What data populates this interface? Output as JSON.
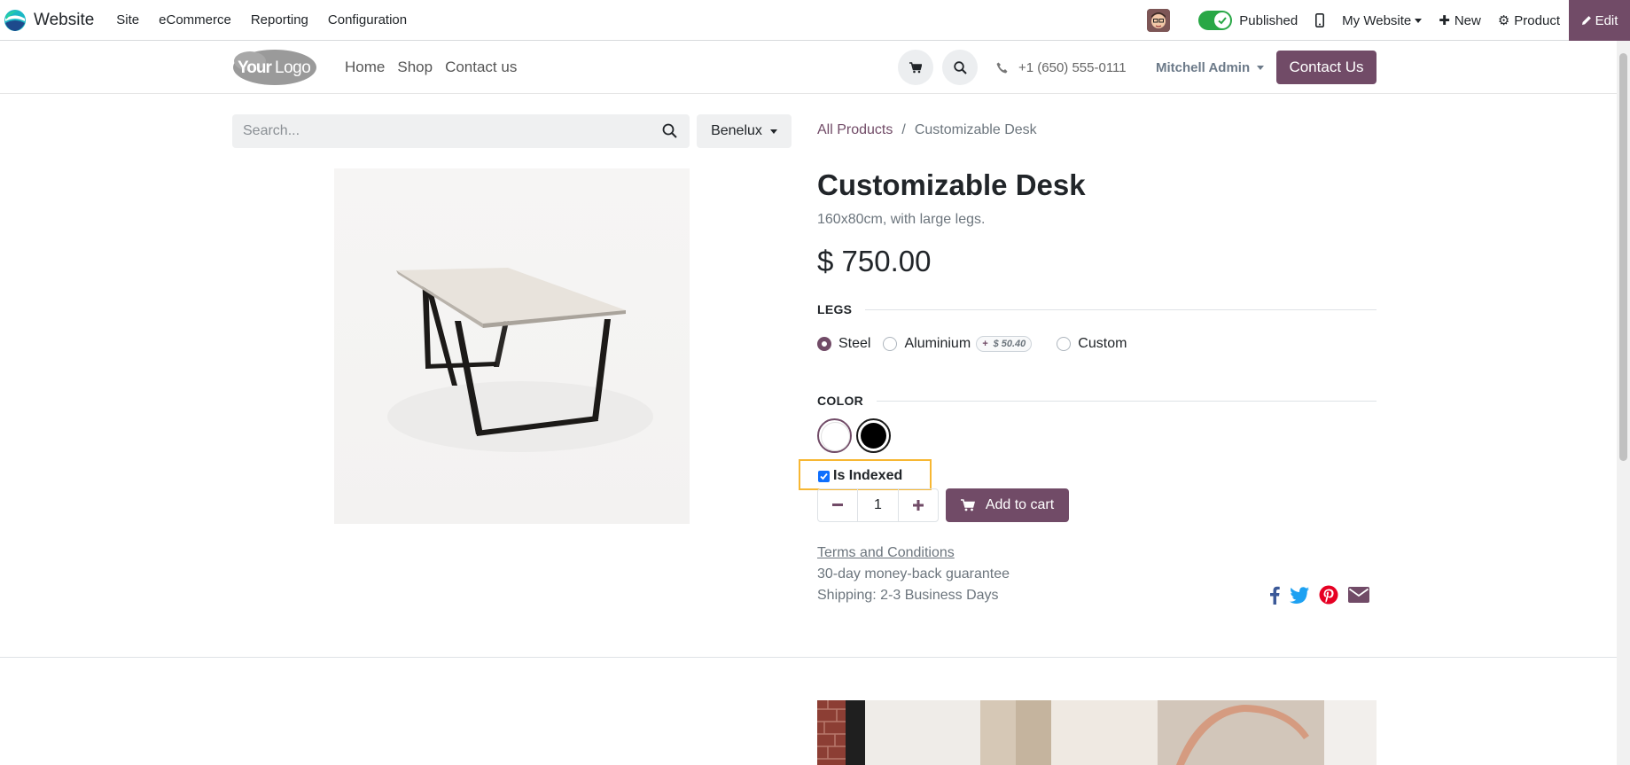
{
  "adminbar": {
    "app_name": "Website",
    "menus": [
      "Site",
      "eCommerce",
      "Reporting",
      "Configuration"
    ],
    "published_label": "Published",
    "my_website_label": "My Website",
    "new_label": "New",
    "product_label": "Product",
    "edit_label": "Edit",
    "accent_color": "#714b67"
  },
  "site": {
    "logo_text": "YourLogo",
    "nav": [
      "Home",
      "Shop",
      "Contact us"
    ],
    "phone": "+1 (650) 555-0111",
    "user": "Mitchell Admin",
    "contact_button": "Contact Us"
  },
  "search": {
    "placeholder": "Search...",
    "pricelist": "Benelux"
  },
  "breadcrumb": {
    "parent": "All Products",
    "separator": "/",
    "current": "Customizable Desk"
  },
  "product": {
    "name": "Customizable Desk",
    "description": "160x80cm, with large legs.",
    "price": "$ 750.00",
    "legs_title": "LEGS",
    "legs_options": [
      {
        "label": "Steel",
        "checked": true
      },
      {
        "label": "Aluminium",
        "checked": false,
        "extra": "$ 50.40",
        "extra_prefix": "+"
      },
      {
        "label": "Custom",
        "checked": false
      }
    ],
    "color_title": "COLOR",
    "colors": [
      "#ffffff",
      "#000000"
    ],
    "is_indexed_label": "Is Indexed",
    "is_indexed_checked": true,
    "quantity": "1",
    "add_to_cart": "Add to cart",
    "terms": "Terms and Conditions",
    "guarantee": "30-day money-back guarantee",
    "shipping": "Shipping: 2-3 Business Days"
  },
  "share_icons": [
    "facebook-icon",
    "twitter-icon",
    "pinterest-icon",
    "envelope-icon"
  ]
}
